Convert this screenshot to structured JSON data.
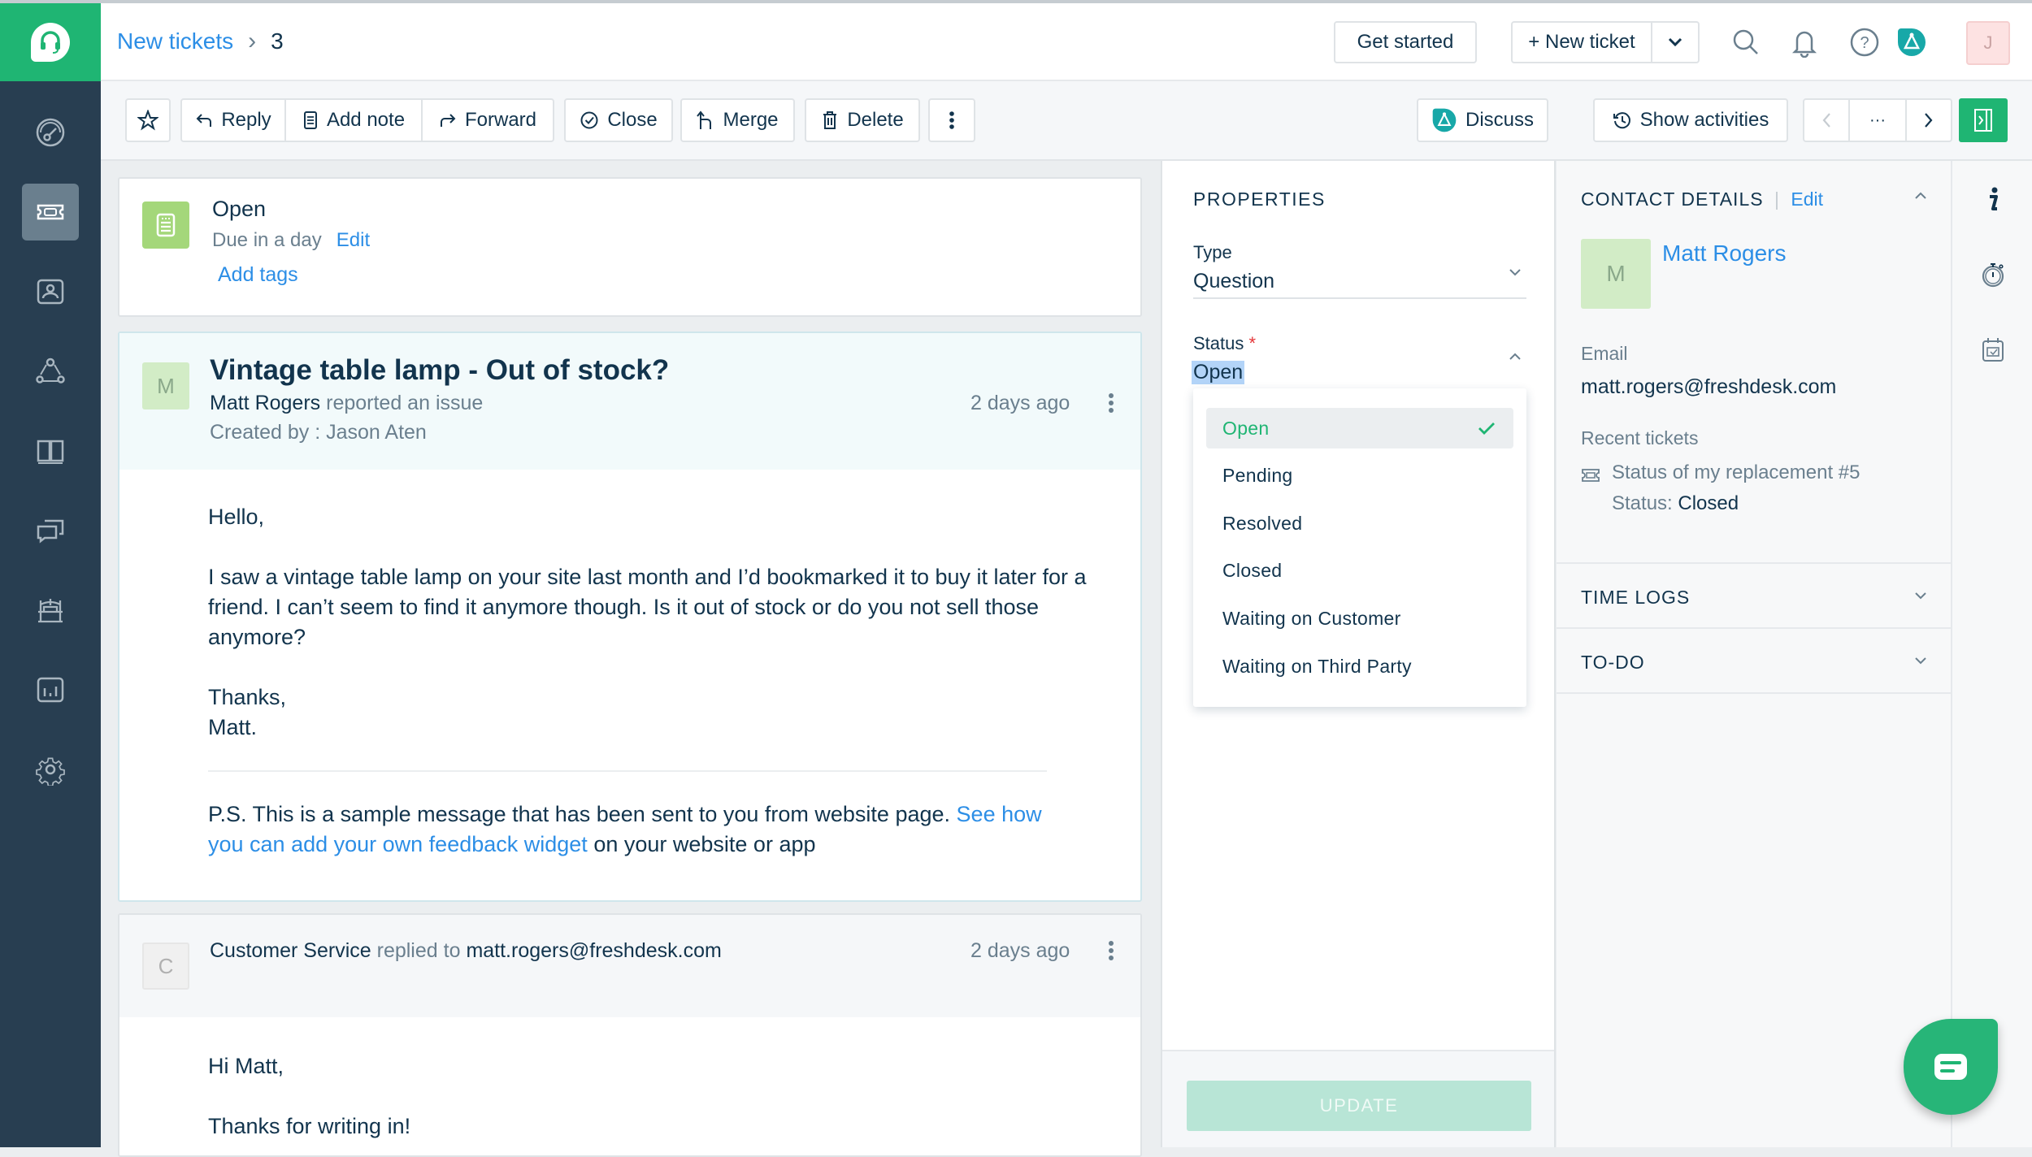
{
  "colors": {
    "brand_green": "#1fb573",
    "sidebar_bg": "#283e51",
    "link_blue": "#2c8ee6",
    "text_dark": "#12344d",
    "muted": "#6a7f8e",
    "required_red": "#e43538"
  },
  "sidebar": {
    "items": [
      {
        "name": "dashboard",
        "icon": "gauge-icon",
        "active": false
      },
      {
        "name": "tickets",
        "icon": "ticket-icon",
        "active": true
      },
      {
        "name": "contacts",
        "icon": "contact-card-icon",
        "active": false
      },
      {
        "name": "social",
        "icon": "network-icon",
        "active": false
      },
      {
        "name": "solutions",
        "icon": "book-icon",
        "active": false
      },
      {
        "name": "forums",
        "icon": "chat-bubbles-icon",
        "active": false
      },
      {
        "name": "admin-groups",
        "icon": "seat-icon",
        "active": false
      },
      {
        "name": "reports",
        "icon": "bar-chart-icon",
        "active": false
      },
      {
        "name": "settings",
        "icon": "gear-icon",
        "active": false
      }
    ]
  },
  "header": {
    "breadcrumb_link": "New tickets",
    "breadcrumb_current": "3",
    "get_started": "Get started",
    "new_ticket": "+ New ticket",
    "avatar_initial": "J"
  },
  "toolbar": {
    "reply": "Reply",
    "add_note": "Add note",
    "forward": "Forward",
    "close": "Close",
    "merge": "Merge",
    "delete": "Delete",
    "discuss": "Discuss",
    "show_activities": "Show activities",
    "more_nav": "···"
  },
  "status_card": {
    "status": "Open",
    "due": "Due in a day",
    "edit": "Edit",
    "add_tags": "Add tags"
  },
  "ticket": {
    "avatar_initial": "M",
    "subject": "Vintage table lamp - Out of stock?",
    "requester": "Matt Rogers",
    "action": "reported an issue",
    "created_by": "Created by : Jason Aten",
    "time": "2 days ago",
    "body": {
      "greeting": "Hello,",
      "paragraph": "I saw a vintage table lamp on your site last month and I’d bookmarked it to buy it later for a friend. I can’t seem to find it anymore though. Is it out of stock or do you not sell those anymore?",
      "signoff_1": "Thanks,",
      "signoff_2": "Matt.",
      "ps_text": "P.S. This is a sample message that has been sent to you from website page.",
      "ps_link": "See how you can add your own feedback widget",
      "ps_tail": "on your website or app"
    }
  },
  "reply": {
    "avatar_initial": "C",
    "author": "Customer Service",
    "action": "replied to",
    "recipient": "matt.rogers@freshdesk.com",
    "time": "2 days ago",
    "greeting": "Hi Matt,",
    "line": "Thanks for writing in!"
  },
  "properties": {
    "title": "PROPERTIES",
    "type_label": "Type",
    "type_value": "Question",
    "status_label": "Status",
    "required_mark": "*",
    "status_value": "Open",
    "status_options": [
      {
        "label": "Open",
        "selected": true
      },
      {
        "label": "Pending",
        "selected": false
      },
      {
        "label": "Resolved",
        "selected": false
      },
      {
        "label": "Closed",
        "selected": false
      },
      {
        "label": "Waiting on Customer",
        "selected": false
      },
      {
        "label": "Waiting on Third Party",
        "selected": false
      }
    ],
    "update_button": "UPDATE"
  },
  "contact": {
    "title": "CONTACT DETAILS",
    "edit": "Edit",
    "avatar_initial": "M",
    "name": "Matt Rogers",
    "email_label": "Email",
    "email": "matt.rogers@freshdesk.com",
    "recent_label": "Recent tickets",
    "recent_ticket": "Status of my replacement #5",
    "recent_status_label": "Status:",
    "recent_status": "Closed",
    "time_logs": "TIME LOGS",
    "todo": "TO-DO"
  }
}
